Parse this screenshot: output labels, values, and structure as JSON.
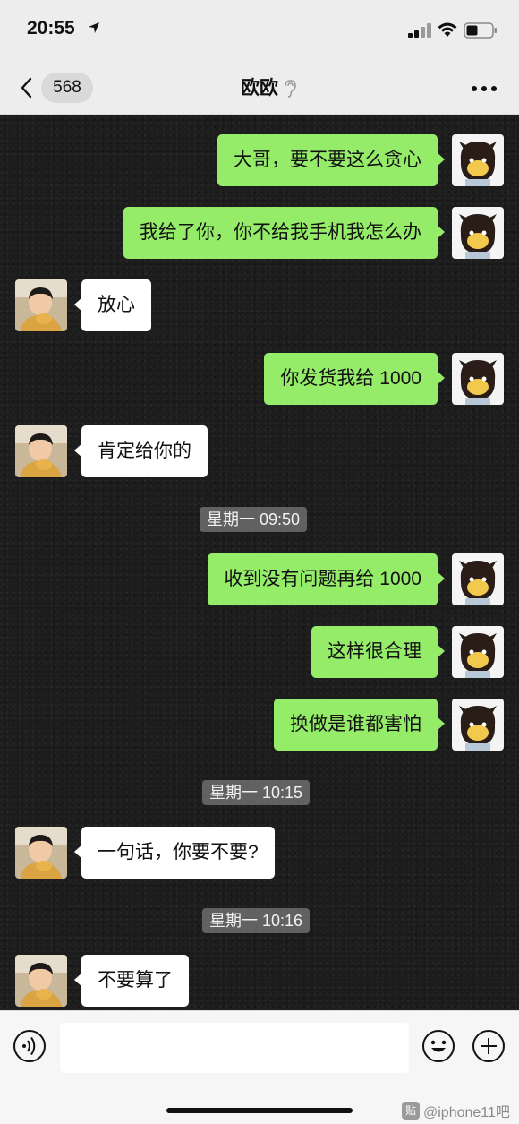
{
  "status_bar": {
    "time": "20:55"
  },
  "nav": {
    "unread_count": "568",
    "title": "欧欧"
  },
  "messages": [
    {
      "side": "out",
      "text": "大哥，要不要这么贪心"
    },
    {
      "side": "out",
      "text": "我给了你，你不给我手机我怎么办"
    },
    {
      "side": "in",
      "text": "放心"
    },
    {
      "side": "out",
      "text": "你发货我给 1000"
    },
    {
      "side": "in",
      "text": "肯定给你的"
    },
    {
      "side": "out",
      "text": "收到没有问题再给 1000"
    },
    {
      "side": "out",
      "text": "这样很合理"
    },
    {
      "side": "out",
      "text": "换做是谁都害怕"
    },
    {
      "side": "in",
      "text": "一句话，你要不要?"
    },
    {
      "side": "in",
      "text": "不要算了"
    }
  ],
  "timestamps": [
    "星期一 09:50",
    "星期一 10:15",
    "星期一 10:16"
  ],
  "input": {
    "placeholder": ""
  },
  "watermark": {
    "text": "@iphone11吧"
  },
  "icons": {
    "back": "chevron-left-icon",
    "ear": "ear-icon",
    "more": "more-dots-icon",
    "voice": "voice-icon",
    "emoji": "emoji-icon",
    "plus": "plus-icon"
  },
  "colors": {
    "outgoing_bubble": "#95ec69",
    "incoming_bubble": "#ffffff",
    "chat_background": "#1c1c1c"
  }
}
